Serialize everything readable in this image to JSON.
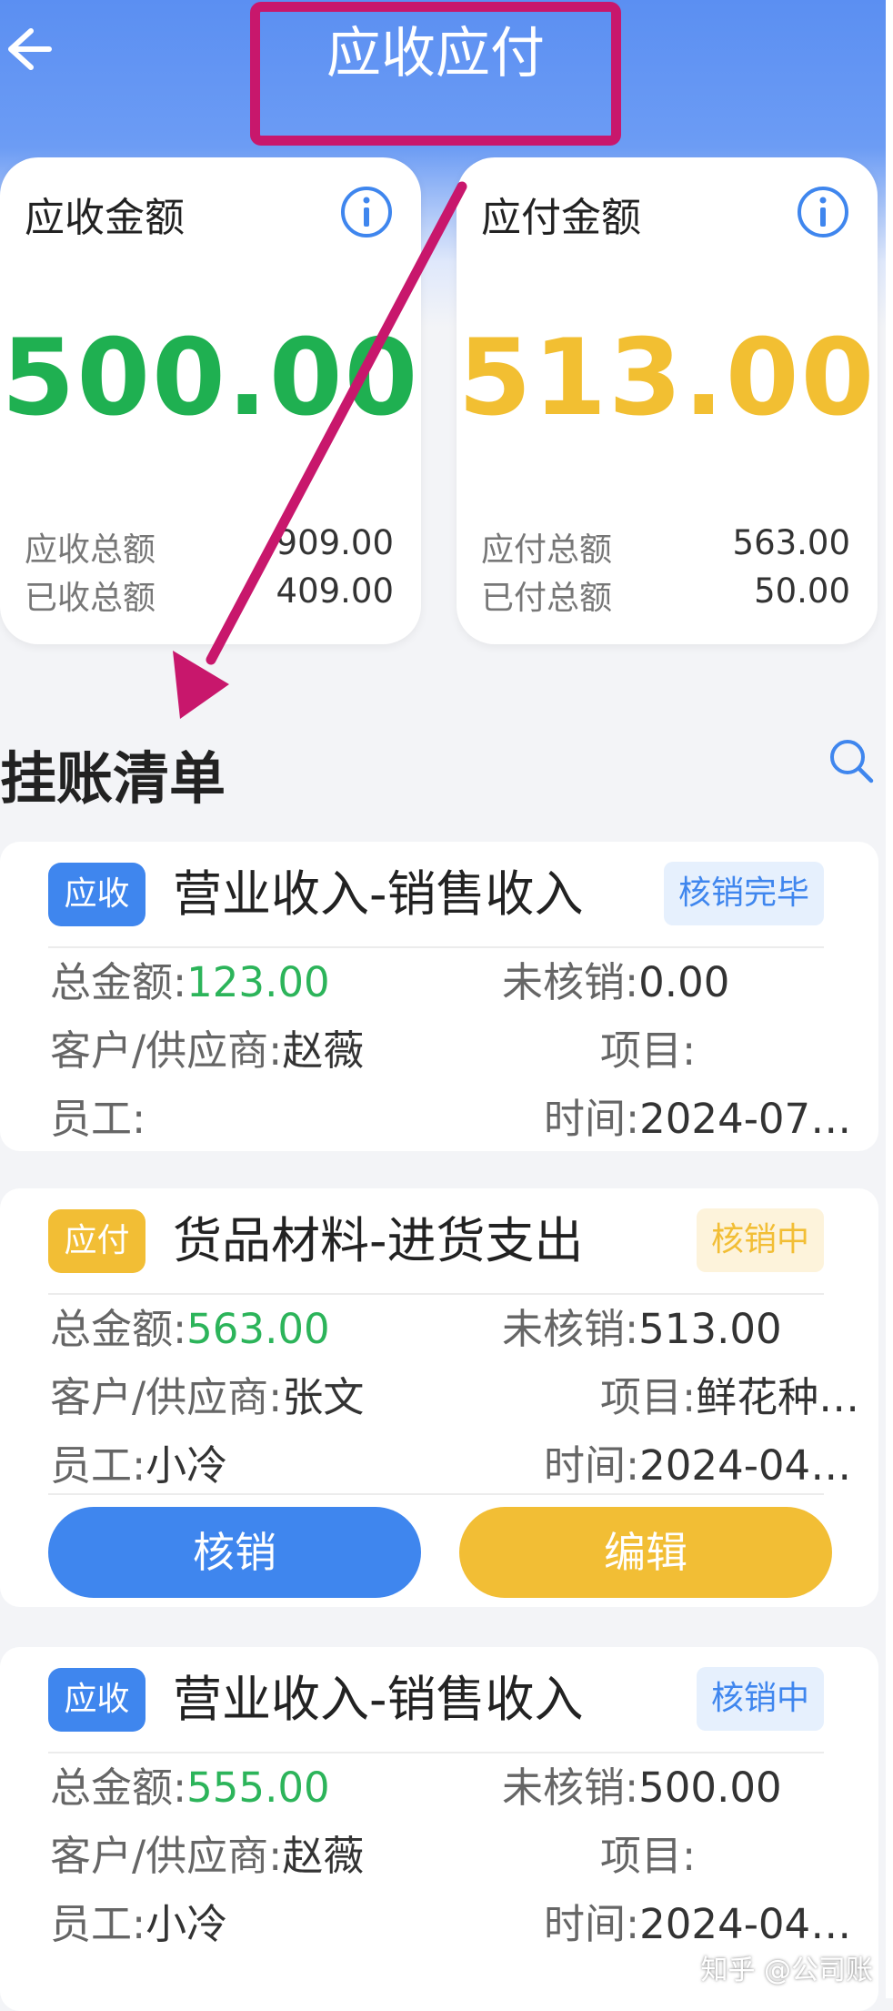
{
  "header": {
    "title": "应收应付"
  },
  "summary": {
    "receivable": {
      "title": "应收金额",
      "amount": "500.00",
      "total_label": "应收总额",
      "total_value": "909.00",
      "received_label": "已收总额",
      "received_value": "409.00"
    },
    "payable": {
      "title": "应付金额",
      "amount": "513.00",
      "total_label": "应付总额",
      "total_value": "563.00",
      "paid_label": "已付总额",
      "paid_value": "50.00"
    }
  },
  "section": {
    "title": "挂账清单"
  },
  "labels": {
    "total": "总金额:",
    "unsettled": "未核销:",
    "party": "客户/供应商:",
    "project": "项目:",
    "staff": "员工:",
    "time": "时间:"
  },
  "entries": [
    {
      "tag": "应收",
      "title": "营业收入-销售收入",
      "status": "核销完毕",
      "total": "123.00",
      "unsettled": "0.00",
      "party": "赵薇",
      "project": "",
      "staff": "",
      "time": "2024-07…"
    },
    {
      "tag": "应付",
      "title": "货品材料-进货支出",
      "status": "核销中",
      "total": "563.00",
      "unsettled": "513.00",
      "party": "张文",
      "project": "鲜花种…",
      "staff": "小冷",
      "time": "2024-04…",
      "actions": {
        "settle": "核销",
        "edit": "编辑"
      }
    },
    {
      "tag": "应收",
      "title": "营业收入-销售收入",
      "status": "核销中",
      "total": "555.00",
      "unsettled": "500.00",
      "party": "赵薇",
      "project": "",
      "staff": "小冷",
      "time": "2024-04…"
    }
  ],
  "watermark": "知乎 @公司账",
  "colors": {
    "header_blue": "#5b8ff2",
    "receivable_green": "#1fb051",
    "payable_yellow": "#f2bf32",
    "primary_blue": "#3f86ee",
    "annotation_magenta": "#c8176c"
  }
}
